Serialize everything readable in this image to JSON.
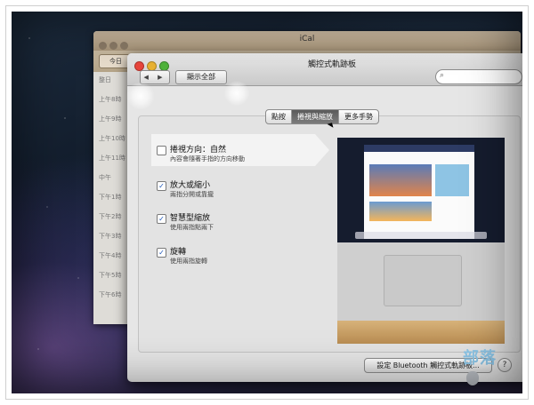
{
  "ical": {
    "title": "iCal",
    "today_button": "今日",
    "times": [
      "整日",
      "上午8時",
      "上午9時",
      "上午10時",
      "上午11時",
      "中午",
      "下午1時",
      "下午2時",
      "下午3時",
      "下午4時",
      "下午5時",
      "下午6時"
    ]
  },
  "pref": {
    "title": "觸控式軌跡板",
    "nav_arrows": "◀ ▶",
    "show_all": "顯示全部",
    "search_placeholder": "",
    "tabs": [
      {
        "label": "點按",
        "selected": false
      },
      {
        "label": "捲視與縮放",
        "selected": true
      },
      {
        "label": "更多手勢",
        "selected": false
      }
    ],
    "options": [
      {
        "title": "捲視方向：自然",
        "subtitle": "內容會隨著手指的方向移動",
        "checked": false
      },
      {
        "title": "放大或縮小",
        "subtitle": "兩指分開或靠攏",
        "checked": true
      },
      {
        "title": "智慧型縮放",
        "subtitle": "使用兩指點兩下",
        "checked": true
      },
      {
        "title": "旋轉",
        "subtitle": "使用兩指旋轉",
        "checked": true
      }
    ],
    "bluetooth_button": "設定 Bluetooth 觸控式軌跡板...",
    "help_label": "?"
  },
  "watermark": "部落",
  "colors": {
    "checkmark": "#1b55b8",
    "selected_tab": "#6a6a6a",
    "watermark": "#8cc6e8"
  }
}
